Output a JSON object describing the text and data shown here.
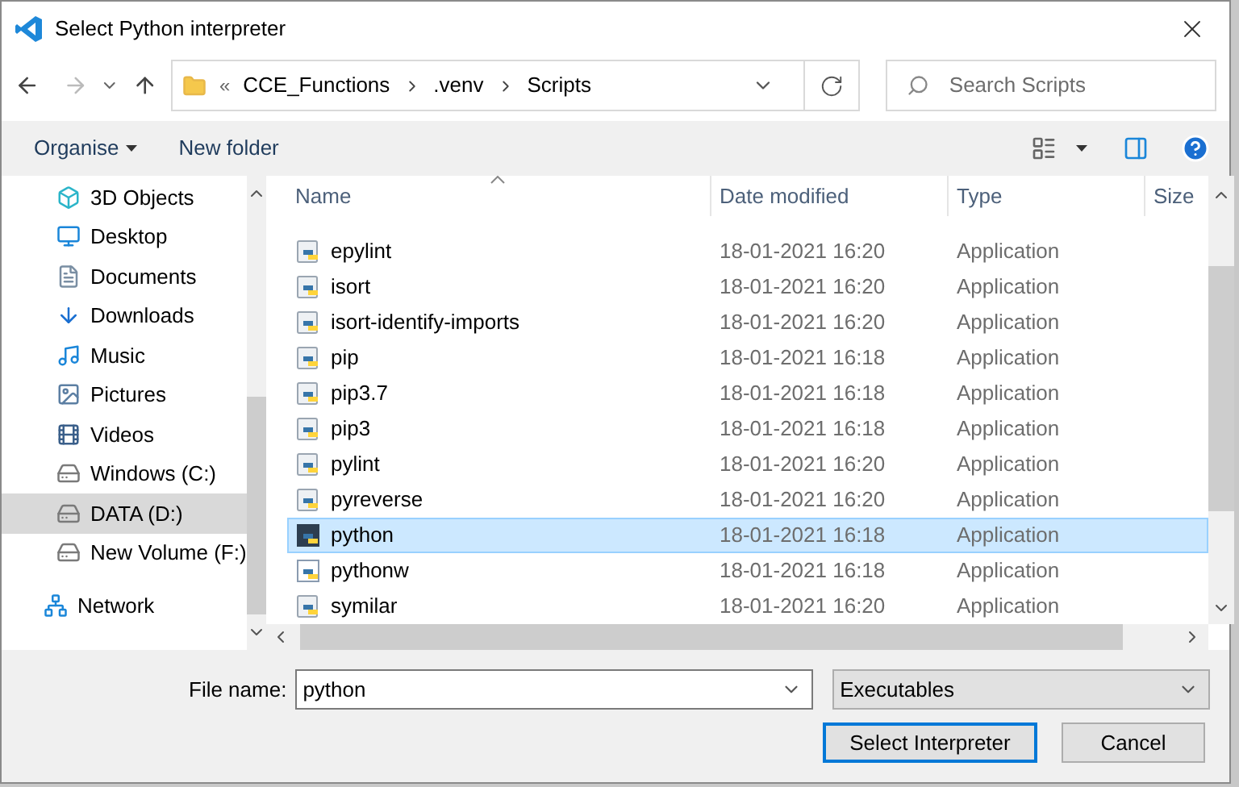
{
  "window": {
    "title": "Select Python interpreter"
  },
  "address_bar": {
    "overflow": "«",
    "crumbs": [
      "CCE_Functions",
      ".venv",
      "Scripts"
    ]
  },
  "search": {
    "placeholder": "Search Scripts"
  },
  "toolbar": {
    "organise": "Organise",
    "new_folder": "New folder"
  },
  "sidebar": {
    "items": [
      {
        "label": "3D Objects",
        "kind": "objects",
        "selected": false
      },
      {
        "label": "Desktop",
        "kind": "desktop",
        "selected": false
      },
      {
        "label": "Documents",
        "kind": "documents",
        "selected": false
      },
      {
        "label": "Downloads",
        "kind": "downloads",
        "selected": false
      },
      {
        "label": "Music",
        "kind": "music",
        "selected": false
      },
      {
        "label": "Pictures",
        "kind": "pictures",
        "selected": false
      },
      {
        "label": "Videos",
        "kind": "videos",
        "selected": false
      },
      {
        "label": "Windows (C:)",
        "kind": "drive",
        "selected": false
      },
      {
        "label": "DATA (D:)",
        "kind": "drive",
        "selected": true
      },
      {
        "label": "New Volume (F:)",
        "kind": "drive",
        "selected": false
      }
    ],
    "network": {
      "label": "Network",
      "selected": false
    }
  },
  "table": {
    "columns": [
      "Name",
      "Date modified",
      "Type",
      "Size"
    ],
    "rows": [
      {
        "name": "epylint",
        "date": "18-01-2021 16:20",
        "type": "Application",
        "kind": "script",
        "selected": false
      },
      {
        "name": "isort",
        "date": "18-01-2021 16:20",
        "type": "Application",
        "kind": "script",
        "selected": false
      },
      {
        "name": "isort-identify-imports",
        "date": "18-01-2021 16:20",
        "type": "Application",
        "kind": "script",
        "selected": false
      },
      {
        "name": "pip",
        "date": "18-01-2021 16:18",
        "type": "Application",
        "kind": "script",
        "selected": false
      },
      {
        "name": "pip3.7",
        "date": "18-01-2021 16:18",
        "type": "Application",
        "kind": "script",
        "selected": false
      },
      {
        "name": "pip3",
        "date": "18-01-2021 16:18",
        "type": "Application",
        "kind": "script",
        "selected": false
      },
      {
        "name": "pylint",
        "date": "18-01-2021 16:20",
        "type": "Application",
        "kind": "script",
        "selected": false
      },
      {
        "name": "pyreverse",
        "date": "18-01-2021 16:20",
        "type": "Application",
        "kind": "script",
        "selected": false
      },
      {
        "name": "python",
        "date": "18-01-2021 16:18",
        "type": "Application",
        "kind": "console",
        "selected": true
      },
      {
        "name": "pythonw",
        "date": "18-01-2021 16:18",
        "type": "Application",
        "kind": "window",
        "selected": false
      },
      {
        "name": "symilar",
        "date": "18-01-2021 16:20",
        "type": "Application",
        "kind": "script",
        "selected": false
      }
    ]
  },
  "file_name": {
    "label": "File name:",
    "value": "python"
  },
  "file_type": {
    "value": "Executables"
  },
  "buttons": [
    {
      "label": "Select Interpreter",
      "kind": "primary"
    },
    {
      "label": "Cancel",
      "kind": "secondary"
    }
  ]
}
